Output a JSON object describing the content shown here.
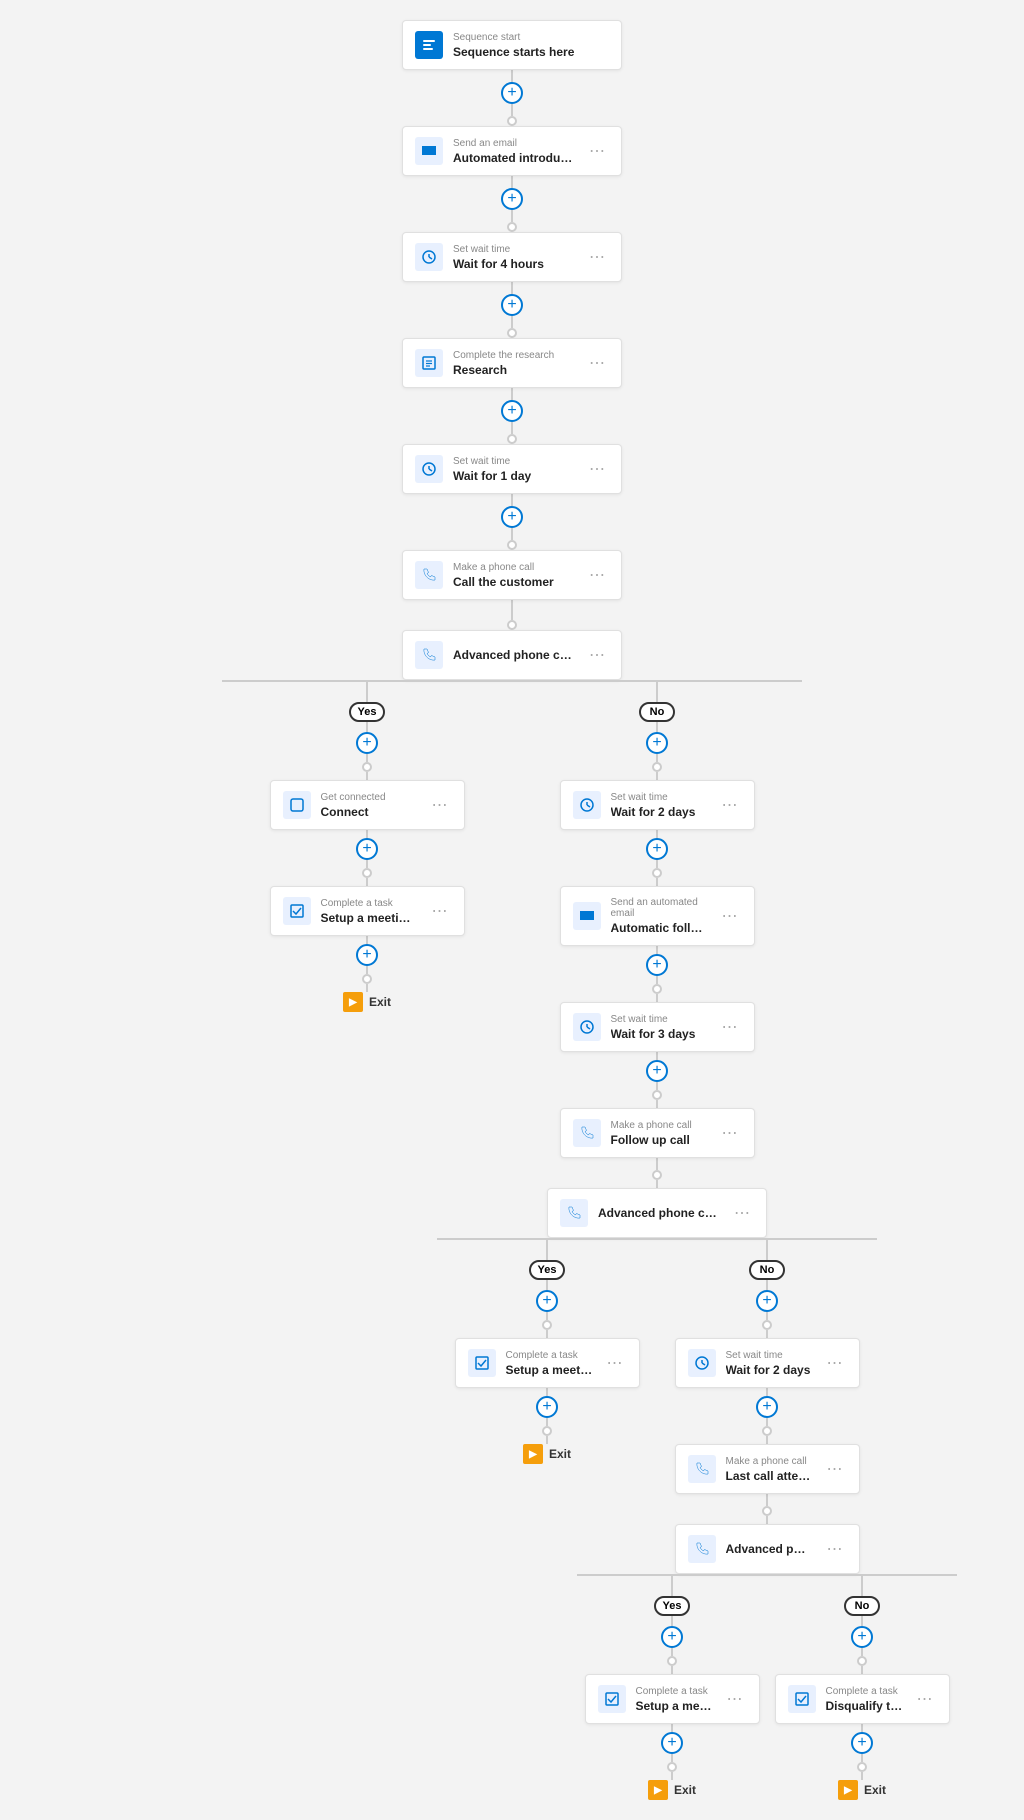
{
  "nodes": {
    "sequence_start": {
      "label": "Sequence start",
      "title": "Sequence starts here"
    },
    "send_email_1": {
      "label": "Send an email",
      "title": "Automated introductory email"
    },
    "wait_4h": {
      "label": "Set wait time",
      "title": "Wait for 4 hours"
    },
    "research": {
      "label": "Complete the research",
      "title": "Research"
    },
    "wait_1d": {
      "label": "Set wait time",
      "title": "Wait for 1 day"
    },
    "phone_call_1": {
      "label": "Make a phone call",
      "title": "Call the customer"
    },
    "phone_condition_1": {
      "label": "",
      "title": "Advanced phone condition"
    },
    "yes_label_1": "Yes",
    "no_label_1": "No",
    "connect": {
      "label": "Get connected",
      "title": "Connect"
    },
    "task_setup_1": {
      "label": "Complete a task",
      "title": "Setup a meeting and move to the next s..."
    },
    "exit_1": "Exit",
    "wait_2d_1": {
      "label": "Set wait time",
      "title": "Wait for 2 days"
    },
    "auto_follow_email": {
      "label": "Send an automated email",
      "title": "Automatic follow up email"
    },
    "wait_3d": {
      "label": "Set wait time",
      "title": "Wait for 3 days"
    },
    "phone_call_2": {
      "label": "Make a phone call",
      "title": "Follow up call"
    },
    "phone_condition_2": {
      "label": "",
      "title": "Advanced phone condition"
    },
    "yes_label_2": "Yes",
    "no_label_2": "No",
    "task_setup_2": {
      "label": "Complete a task",
      "title": "Setup a meeting and move to the next s..."
    },
    "exit_2": "Exit",
    "wait_2d_2": {
      "label": "Set wait time",
      "title": "Wait for 2 days"
    },
    "phone_call_3": {
      "label": "Make a phone call",
      "title": "Last call attempt"
    },
    "phone_condition_3": {
      "label": "",
      "title": "Advanced phone condition"
    },
    "yes_label_3": "Yes",
    "no_label_3": "No",
    "task_setup_3": {
      "label": "Complete a task",
      "title": "Setup a meeting and move to the next s..."
    },
    "task_disqualify": {
      "label": "Complete a task",
      "title": "Disqualify the lead"
    },
    "exit_3": "Exit",
    "exit_4": "Exit"
  }
}
